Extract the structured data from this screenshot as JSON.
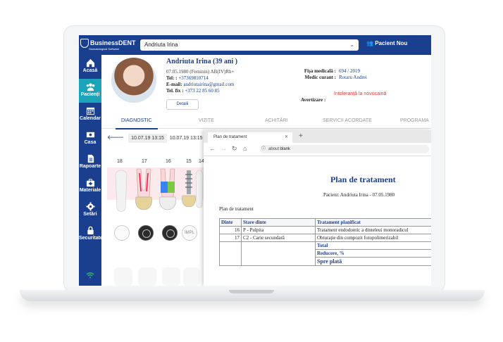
{
  "app": {
    "brand": "BusinessDENT",
    "brand_tagline": "Stomatological Software",
    "selected_patient": "Andriuta Irina",
    "new_patient_label": "Pacient Nou"
  },
  "sidebar": {
    "items": [
      {
        "label": "Acasă",
        "icon": "home-icon"
      },
      {
        "label": "Pacienți",
        "icon": "patients-icon",
        "active": true
      },
      {
        "label": "Calendar",
        "icon": "calendar-icon"
      },
      {
        "label": "Casa",
        "icon": "cash-icon"
      },
      {
        "label": "Rapoarte",
        "icon": "reports-icon"
      },
      {
        "label": "Materiale",
        "icon": "materials-icon"
      },
      {
        "label": "Setări",
        "icon": "gear-icon"
      },
      {
        "label": "Securitate",
        "icon": "lock-icon"
      }
    ]
  },
  "patient": {
    "name": "Andriuta Irina  (39 ani )",
    "birth_line": "07.05.1980 (Feminin) AB(IV)Rh+",
    "tel_label": "Tel: :",
    "tel": "+37369810714",
    "email_label": "E-mail:",
    "email": "andriutairina@gmail.com",
    "telfix_label": "Tel. fix :",
    "telfix": "+373 22 85 60 85",
    "details_button": "Detalii",
    "fisa_label": "Fișa medicală :",
    "fisa_value": "694 / 2019",
    "medic_label": "Medic curant :",
    "medic_value": "Rotaru Andrei",
    "warning_label": "Avertizare :",
    "warning_value": "Intoleranță la novocaină"
  },
  "tabs": [
    "DIAGNOSTIC",
    "VIZITE",
    "ACHITĂRI",
    "SERVICII ACORDATE",
    "PROGRAMA"
  ],
  "odontogram": {
    "dates": [
      "10.07.19 13:15",
      "10.07.19 13:15"
    ],
    "tooth_numbers": [
      "18",
      "17",
      "16",
      "15",
      "14"
    ],
    "implant_label": "IMPL"
  },
  "browser": {
    "tab_title": "Plan de tratament",
    "url_prefix": "about:",
    "url": "blank",
    "doc_title": "Plan de tratament",
    "doc_patient": "Pacient: Andriuta Irina  -  07.05.1980",
    "doc_label": "Plan de tratament",
    "table": {
      "headers": [
        "Dinte",
        "Stare dinte",
        "Tratament planificat"
      ],
      "rows": [
        [
          "16",
          "P - Pulpita",
          "Tratament endodontic a dinteleui monoradicul"
        ],
        [
          "17",
          "C2 - Carie secundară",
          "Obturație din compozit fotopolimerizabil"
        ]
      ],
      "total_label": "Total",
      "discount_label": "Reducere, %",
      "pay_label": "Spre plată"
    }
  },
  "colors": {
    "primary": "#1b3f8f",
    "accent": "#1aa3b9",
    "warning": "#e53935"
  }
}
